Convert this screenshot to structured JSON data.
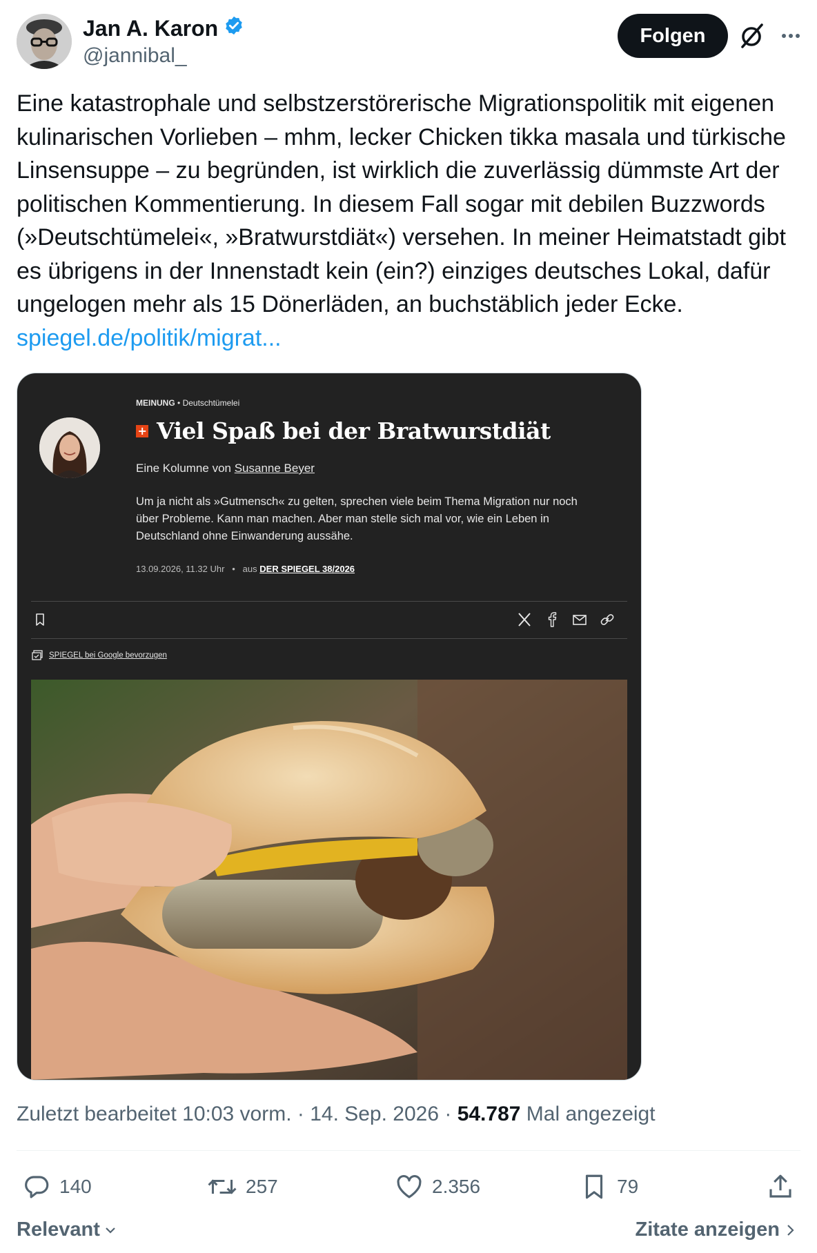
{
  "author": {
    "name": "Jan A. Karon",
    "handle": "@jannibal_",
    "verified": true
  },
  "header": {
    "follow_label": "Folgen"
  },
  "tweet": {
    "text": "Eine katastrophale und selbstzerstörerische Migrationspolitik mit eigenen kulinarischen Vorlieben – mhm, lecker Chicken tikka masala und türkische Linsensuppe – zu begründen, ist wirklich die zuverlässig dümmste Art der politischen Kommentierung. In diesem Fall sogar mit debilen Buzzwords (»Deutschtümelei«, »Bratwurstdiät«) versehen. In meiner Heimatstadt gibt es übrigens in der Innenstadt kein (ein?) einziges deutsches Lokal, dafür ungelogen mehr als 15 Dönerläden, an buchstäblich jeder Ecke.",
    "link": "spiegel.de/politik/migrat..."
  },
  "article": {
    "kicker_section": "MEINUNG",
    "kicker_topic": "Deutschtümelei",
    "plus_badge": "+",
    "headline": "Viel Spaß bei der Bratwurstdiät",
    "byline_prefix": "Eine Kolumne von",
    "byline_author": "Susanne Beyer",
    "teaser": "Um ja nicht als »Gutmensch« zu gelten, sprechen viele beim Thema Migration nur noch über Probleme. Kann man machen. Aber man stelle sich mal vor, wie ein Leben in Deutschland ohne Einwanderung aussähe.",
    "date": "13.09.2026, 11.32 Uhr",
    "issue_prefix": "aus",
    "issue": "DER SPIEGEL 38/2026",
    "google_label": "SPIEGEL bei Google bevorzugen"
  },
  "footer": {
    "timestamp": "Zuletzt bearbeitet 10:03 vorm. · 14. Sep. 2026 · ",
    "views": "54.787",
    "views_suffix": " Mal angezeigt",
    "replies": "140",
    "reposts": "257",
    "likes": "2.356",
    "bookmarks": "79",
    "sort_label": "Relevant",
    "quotes_label": "Zitate anzeigen"
  },
  "colors": {
    "link": "#1d9bf0",
    "verified": "#1d9bf0",
    "muted": "#536471",
    "card_bg": "#222222",
    "plus_badge": "#e64415"
  }
}
